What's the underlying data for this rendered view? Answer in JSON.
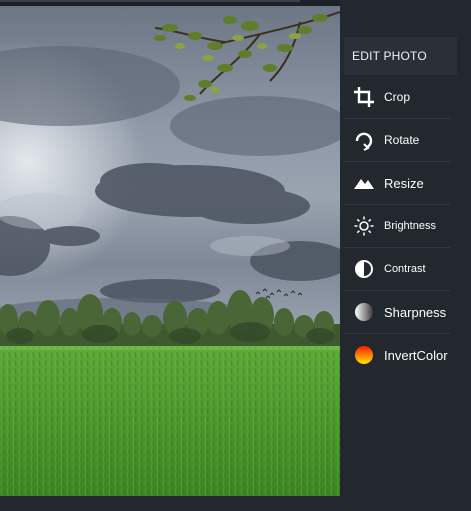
{
  "panel": {
    "title": "EDIT PHOTO",
    "items": [
      {
        "label": "Crop",
        "icon": "crop-icon"
      },
      {
        "label": "Rotate",
        "icon": "rotate-icon"
      },
      {
        "label": "Resize",
        "icon": "resize-icon"
      },
      {
        "label": "Brightness",
        "icon": "brightness-icon"
      },
      {
        "label": "Contrast",
        "icon": "contrast-icon"
      },
      {
        "label": "Sharpness",
        "icon": "sharpness-icon"
      },
      {
        "label": "InvertColor",
        "icon": "invert-color-icon"
      }
    ]
  },
  "colors": {
    "panel_background": "#23272e",
    "header_background": "#2b2f37",
    "text": "#ffffff",
    "divider": "#323741"
  }
}
